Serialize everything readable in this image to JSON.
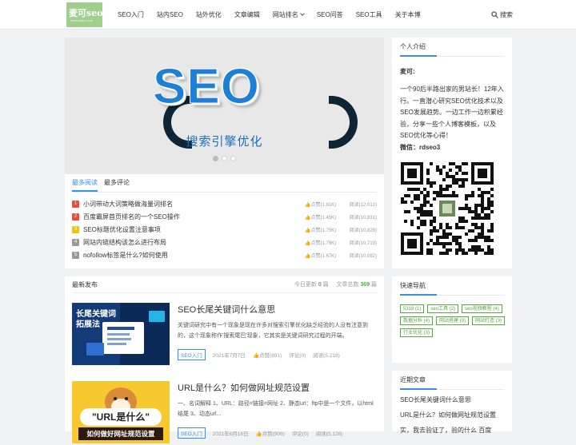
{
  "header": {
    "logo_text": "麦可seo",
    "logo_sub": "www.rdseo.com",
    "nav": [
      {
        "label": "SEO入门",
        "dropdown": false
      },
      {
        "label": "站内SEO",
        "dropdown": false
      },
      {
        "label": "站外优化",
        "dropdown": false
      },
      {
        "label": "文章编辑",
        "dropdown": false
      },
      {
        "label": "网站排名",
        "dropdown": true
      },
      {
        "label": "SEO问答",
        "dropdown": false
      },
      {
        "label": "SEO工具",
        "dropdown": false
      },
      {
        "label": "关于本博",
        "dropdown": false
      }
    ],
    "search_label": "搜索"
  },
  "banner": {
    "headline": "SEO",
    "subtitle": "搜索引擎优化",
    "slides": 3,
    "active_slide": 1
  },
  "ranking": {
    "tabs": [
      "最多阅读",
      "最多评论"
    ],
    "active_tab": 0,
    "items": [
      {
        "no": "1",
        "title": "小词带动大词策略做海量词排名",
        "likes": "点赞(1.81K)",
        "reads": "阅读(12,013)",
        "color": "#e74c3c"
      },
      {
        "no": "2",
        "title": "百度霸屏首页排名的一个SEO操作",
        "likes": "点赞(1.45K)",
        "reads": "阅读(10,831)",
        "color": "#e74c3c"
      },
      {
        "no": "3",
        "title": "SEO标题优化设置注意事项",
        "likes": "点赞(1.75K)",
        "reads": "阅读(10,828)",
        "color": "#f1c40f"
      },
      {
        "no": "4",
        "title": "网站内链结构该怎么进行布局",
        "likes": "点赞(1.79K)",
        "reads": "阅读(10,719)",
        "color": "#999999"
      },
      {
        "no": "5",
        "title": "nofollow标签是什么?如何使用",
        "likes": "点赞(1.67K)",
        "reads": "阅读(10,082)",
        "color": "#999999"
      }
    ]
  },
  "latest": {
    "title": "最新发布",
    "today_label": "今日更新",
    "today_count": "0",
    "unit": "篇",
    "total_label": "文章总数",
    "total_count": "369",
    "posts": [
      {
        "title": "SEO长尾关键词什么意思",
        "excerpt": "关键词研究中有一个现象是现在许多对搜索引擎优化缺乏经验的人没有注意到的，这个现象称作'搜索尾巴'现象，它其实是关键词研究过程的开端。",
        "category": "SEO入门",
        "date": "2021年7月7日",
        "likes": "点赞(891)",
        "comments": "评论(0)",
        "reads": "阅读(5,218)",
        "thumb_title_1": "长尾关键词",
        "thumb_title_2": "拓展法"
      },
      {
        "title": "URL是什么？如何做网址规范设置",
        "excerpt": "一、名词解释 1、URL：路径=链接=网址 2、静态url：ftp中是一个文件，以html结尾 3、动态url...",
        "category": "SEO入门",
        "date": "2021年6月16日",
        "likes": "点赞(906)",
        "comments": "评论(0)",
        "reads": "阅读(5,126)",
        "thumb_title_1": "\"URL是什么\"",
        "thumb_title_2": "如何做好网址规范设置"
      }
    ]
  },
  "about": {
    "title": "个人介绍",
    "name": "麦可:",
    "bio": "一个90后半路出家的男站长！12年入行。一直潜心研究SEO优化技术以及SEO发展趋势。一边工作一边积累经验，分享一些个人博客模板，以及SEO优化等心得！",
    "wechat": "微信：rdseo3"
  },
  "tags": {
    "title": "快速导航",
    "items": [
      "5318 (1)",
      "seo工具 (2)",
      "seo视频教程 (4)",
      "数据分析 (4)",
      "网站搭建 (9)",
      "网站打造 (3)",
      "行业优化 (3)"
    ]
  },
  "recent": {
    "title": "近期文章",
    "items": [
      "SEO长尾关键词什么意思",
      "URL是什么？如何做网址规范设置",
      "实，我去验证了，验的什么 百度"
    ]
  },
  "colors": {
    "accent": "#3a8ee6",
    "green": "#5aa63f"
  }
}
